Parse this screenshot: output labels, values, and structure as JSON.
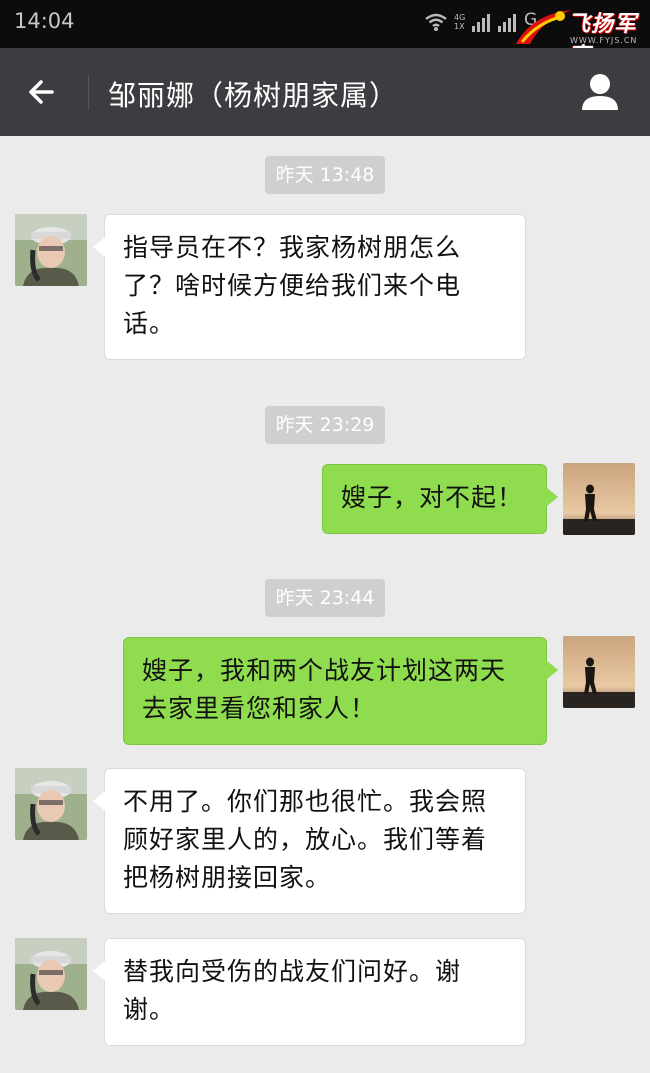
{
  "status_bar": {
    "time": "14:04",
    "network_label": "4G 1X",
    "network_g": "G",
    "logo_text": "飞扬军事",
    "logo_url": "WWW.FYJS.CN"
  },
  "header": {
    "title": "邹丽娜（杨树朋家属）",
    "back_icon": "arrow-left-icon",
    "profile_icon": "person-icon"
  },
  "colors": {
    "background": "#ebebeb",
    "title_bar": "#3b3d40",
    "outgoing_bubble": "#8fdc4f",
    "incoming_bubble": "#ffffff",
    "time_chip": "#cfcfcf"
  },
  "messages": [
    {
      "type": "time",
      "text": "昨天 13:48"
    },
    {
      "type": "incoming",
      "lines": [
        "指导员在不？我家杨树朋怎么",
        "了？啥时候方便给我们来个电",
        "话。"
      ]
    },
    {
      "type": "time",
      "text": "昨天 23:29"
    },
    {
      "type": "outgoing",
      "lines": [
        "嫂子，对不起！"
      ]
    },
    {
      "type": "time",
      "text": "昨天 23:44"
    },
    {
      "type": "outgoing",
      "lines": [
        "嫂子，我和两个战友计划这两天",
        "去家里看您和家人！"
      ]
    },
    {
      "type": "incoming",
      "lines": [
        "不用了。你们那也很忙。我会照",
        "顾好家里人的，放心。我们等着",
        "把杨树朋接回家。"
      ]
    },
    {
      "type": "incoming",
      "lines": [
        "替我向受伤的战友们问好。谢",
        "谢。"
      ]
    }
  ]
}
